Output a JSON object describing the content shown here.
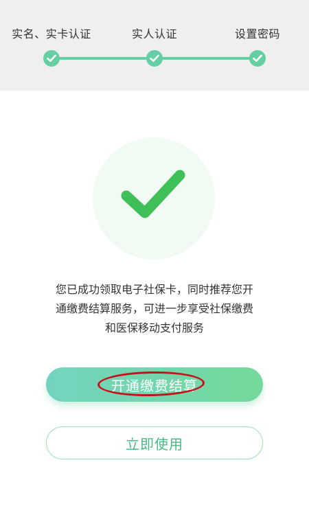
{
  "stepper": {
    "steps": [
      {
        "label": "实名、实卡认证",
        "status": "done"
      },
      {
        "label": "实人认证",
        "status": "done"
      },
      {
        "label": "设置密码",
        "status": "done"
      }
    ],
    "accent_color": "#63cfa3"
  },
  "result": {
    "icon": "check-icon",
    "icon_color": "#3fbf58",
    "message_lines": [
      "您已成功领取电子社保卡，同时推荐您开",
      "通缴费结算服务，可进一步享受社保缴费",
      "和医保移动支付服务"
    ]
  },
  "actions": {
    "primary_label": "开通缴费结算",
    "primary_highlight": "red-ellipse-annotation",
    "secondary_label": "立即使用"
  }
}
